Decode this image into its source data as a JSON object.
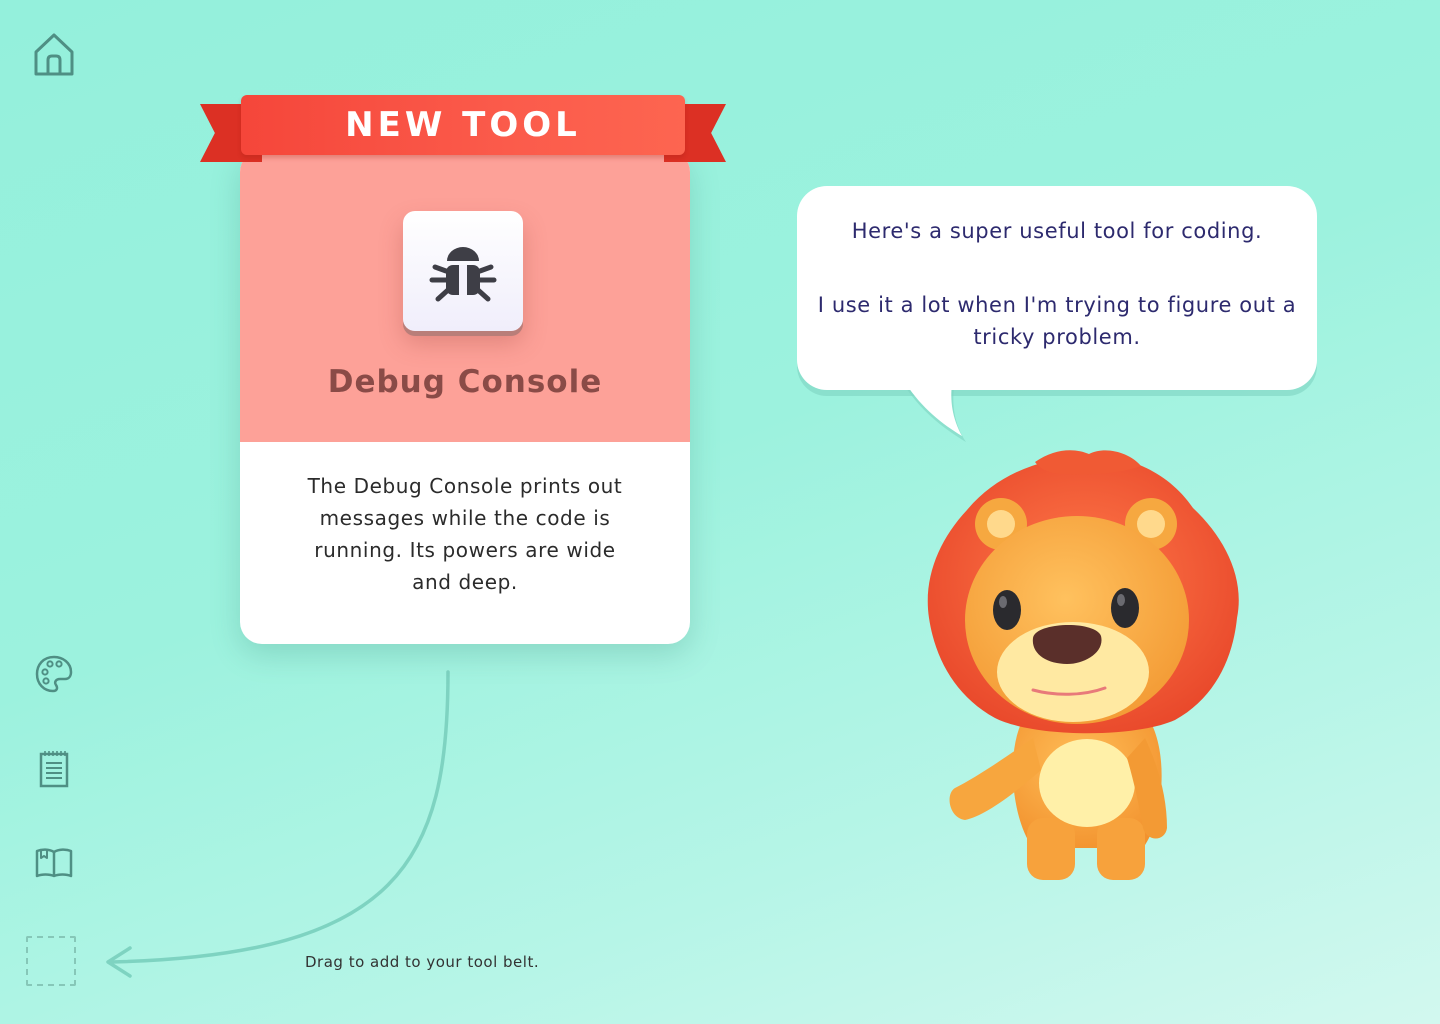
{
  "nav": {
    "home": {
      "icon": "home-icon"
    },
    "palette": {
      "icon": "palette-icon"
    },
    "notepad": {
      "icon": "notepad-icon"
    },
    "book": {
      "icon": "book-icon"
    },
    "tool_belt_slot": {
      "icon": "empty-slot"
    }
  },
  "card": {
    "ribbon_label": "NEW TOOL",
    "icon": "bug-icon",
    "title": "Debug Console",
    "description": "The Debug Console prints out messages while the code is running. Its powers are wide and deep."
  },
  "speech": {
    "line1": "Here's a super useful tool for coding.",
    "line2": "I use it a lot when I'm trying to figure out a tricky problem."
  },
  "drag_hint": "Drag to add to your tool belt.",
  "character": {
    "icon": "lion-character"
  },
  "colors": {
    "background": "#9cf2de",
    "ribbon": "#fb5b4b",
    "card_top": "#fda198",
    "title": "#8a4b47",
    "speech_text": "#2d2a6e",
    "icon_stroke": "#4f8f84"
  }
}
